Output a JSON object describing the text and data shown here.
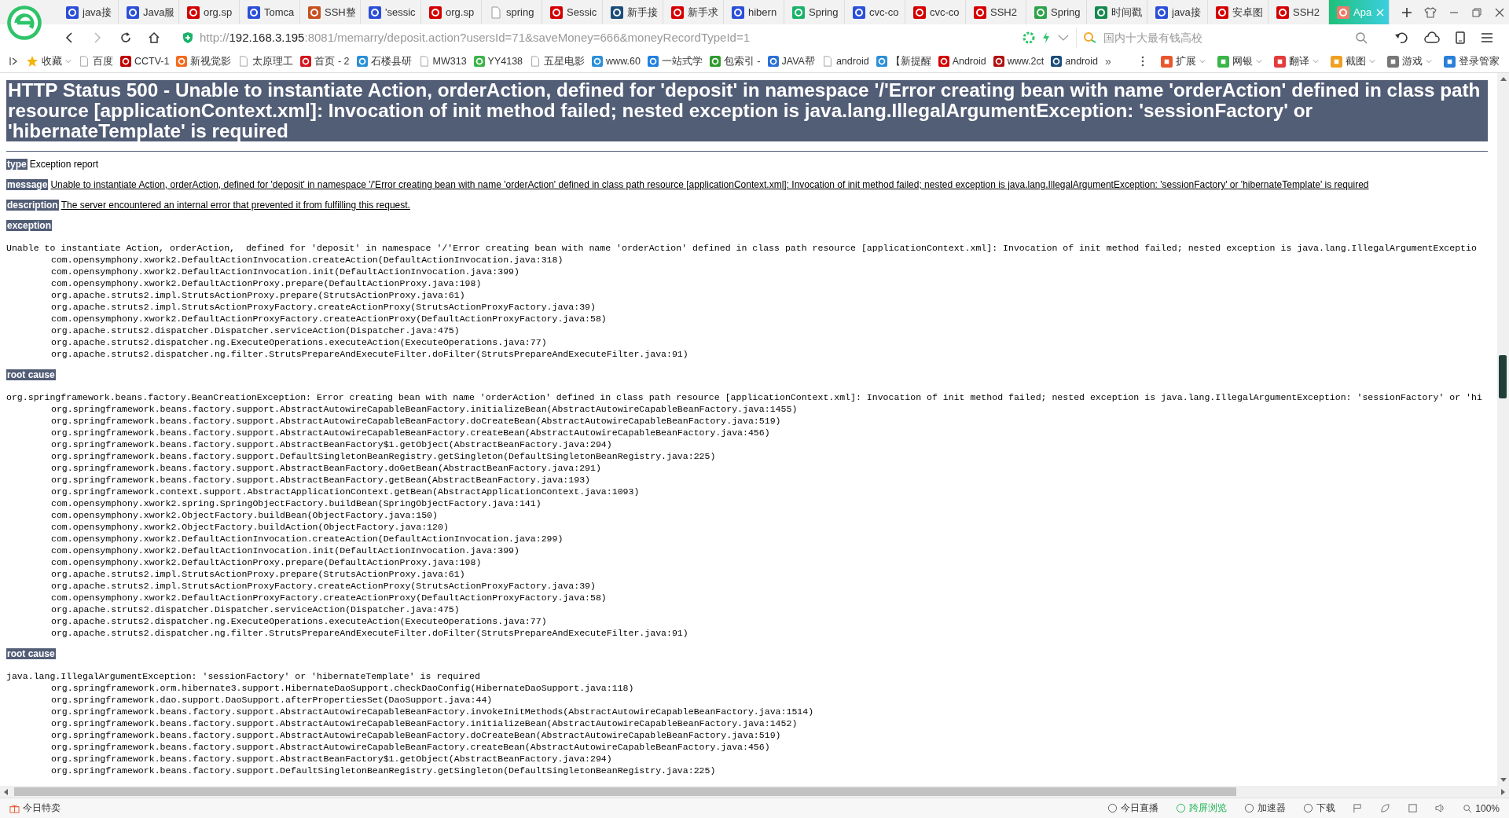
{
  "tabs": [
    {
      "label": "java接",
      "kind": "badge",
      "color": "#2b4fd8",
      "selected": false
    },
    {
      "label": "Java服",
      "kind": "badge",
      "color": "#2b4fd8",
      "selected": false
    },
    {
      "label": "org.sp",
      "kind": "badge",
      "color": "#d40000",
      "selected": false
    },
    {
      "label": "Tomca",
      "kind": "badge",
      "color": "#2b4fd8",
      "selected": false
    },
    {
      "label": "SSH整",
      "kind": "badge",
      "color": "#c8501e",
      "selected": false
    },
    {
      "label": "'sessic",
      "kind": "badge",
      "color": "#2b4fd8",
      "selected": false
    },
    {
      "label": "org.sp",
      "kind": "badge",
      "color": "#d40000",
      "selected": false
    },
    {
      "label": "spring",
      "kind": "page",
      "selected": false
    },
    {
      "label": "Sessic",
      "kind": "badge",
      "color": "#d40000",
      "selected": false
    },
    {
      "label": "新手接",
      "kind": "badge",
      "color": "#1b4d7a",
      "selected": false
    },
    {
      "label": "新手求",
      "kind": "badge",
      "color": "#d40000",
      "selected": false
    },
    {
      "label": "hibern",
      "kind": "badge",
      "color": "#2b4fd8",
      "selected": false
    },
    {
      "label": "Spring",
      "kind": "badge",
      "color": "#19b36b",
      "selected": false
    },
    {
      "label": "cvc-co",
      "kind": "badge",
      "color": "#2b4fd8",
      "selected": false
    },
    {
      "label": "cvc-co",
      "kind": "badge",
      "color": "#d40000",
      "selected": false
    },
    {
      "label": "SSH2",
      "kind": "badge",
      "color": "#d40000",
      "selected": false
    },
    {
      "label": "Spring",
      "kind": "badge",
      "color": "#2fa34b",
      "selected": false
    },
    {
      "label": "时间戳",
      "kind": "badge",
      "color": "#16894f",
      "selected": false
    },
    {
      "label": "java接",
      "kind": "badge",
      "color": "#2b4fd8",
      "selected": false
    },
    {
      "label": "安卓图",
      "kind": "badge",
      "color": "#d40000",
      "selected": false
    },
    {
      "label": "SSH2",
      "kind": "badge",
      "color": "#d40000",
      "selected": false
    },
    {
      "label": "Apa",
      "kind": "badge",
      "color": "#f07a6a",
      "selected": true
    }
  ],
  "address": {
    "scheme": "http://",
    "host": "192.168.3.195",
    "rest": ":8081/memarry/deposit.action?usersId=71&saveMoney=666&moneyRecordTypeId=1"
  },
  "search": {
    "placeholder": "国内十大最有钱高校"
  },
  "bookmarks": [
    {
      "label": "收藏",
      "kind": "star",
      "color": "#f5b400"
    },
    {
      "label": "百度",
      "kind": "page"
    },
    {
      "label": "CCTV-1",
      "kind": "badge",
      "color": "#c00000"
    },
    {
      "label": "新视觉影",
      "kind": "badge",
      "color": "#f26b1d"
    },
    {
      "label": "太原理工",
      "kind": "page"
    },
    {
      "label": "首页 - 2",
      "kind": "badge",
      "color": "#d4141c"
    },
    {
      "label": "石楼县研",
      "kind": "badge",
      "color": "#2a8fd8"
    },
    {
      "label": "MW313",
      "kind": "page"
    },
    {
      "label": "YY4138",
      "kind": "badge",
      "color": "#3bb54a"
    },
    {
      "label": "五星电影",
      "kind": "page"
    },
    {
      "label": "www.60",
      "kind": "badge",
      "color": "#2a8fd8"
    },
    {
      "label": "一站式学",
      "kind": "badge",
      "color": "#1f7fe0"
    },
    {
      "label": "包索引 -",
      "kind": "badge",
      "color": "#2e9b2e"
    },
    {
      "label": "JAVA帮",
      "kind": "badge",
      "color": "#2a6fd8"
    },
    {
      "label": "android",
      "kind": "page"
    },
    {
      "label": "【新提醒",
      "kind": "badge",
      "color": "#2a8fd8"
    },
    {
      "label": "Android",
      "kind": "badge",
      "color": "#d40000"
    },
    {
      "label": "www.2ct",
      "kind": "badge",
      "color": "#b01010"
    },
    {
      "label": "android",
      "kind": "badge",
      "color": "#1b4d7a"
    }
  ],
  "more": "»",
  "extensions": [
    {
      "label": "扩展",
      "color": "#e8552e",
      "dropdown": true
    },
    {
      "label": "网银",
      "color": "#3bb54a",
      "dropdown": true
    },
    {
      "label": "翻译",
      "color": "#e33c3c",
      "dropdown": true
    },
    {
      "label": "截图",
      "color": "#f0a020",
      "dropdown": true
    },
    {
      "label": "游戏",
      "color": "#777777",
      "dropdown": true
    },
    {
      "label": "登录管家",
      "color": "#2a7fd8",
      "dropdown": false
    }
  ],
  "report": {
    "title": "HTTP Status 500 - Unable to instantiate Action, orderAction, defined for 'deposit' in namespace '/'Error creating bean with name 'orderAction' defined in class path resource [applicationContext.xml]: Invocation of init method failed; nested exception is java.lang.IllegalArgumentException: 'sessionFactory' or 'hibernateTemplate' is required",
    "fields": [
      {
        "label": "type",
        "text": "Exception report",
        "underlined": false
      },
      {
        "label": "message",
        "text": "Unable to instantiate Action, orderAction, defined for 'deposit' in namespace '/'Error creating bean with name 'orderAction' defined in class path resource [applicationContext.xml]: Invocation of init method failed; nested exception is java.lang.IllegalArgumentException: 'sessionFactory' or 'hibernateTemplate' is required",
        "underlined": true
      },
      {
        "label": "description",
        "text": "The server encountered an internal error that prevented it from fulfilling this request.",
        "underlined": true
      }
    ],
    "traces": [
      {
        "label": "exception",
        "first": "Unable to instantiate Action, orderAction,  defined for 'deposit' in namespace '/'Error creating bean with name 'orderAction' defined in class path resource [applicationContext.xml]: Invocation of init method failed; nested exception is java.lang.IllegalArgumentExceptio",
        "frames": [
          "com.opensymphony.xwork2.DefaultActionInvocation.createAction(DefaultActionInvocation.java:318)",
          "com.opensymphony.xwork2.DefaultActionInvocation.init(DefaultActionInvocation.java:399)",
          "com.opensymphony.xwork2.DefaultActionProxy.prepare(DefaultActionProxy.java:198)",
          "org.apache.struts2.impl.StrutsActionProxy.prepare(StrutsActionProxy.java:61)",
          "org.apache.struts2.impl.StrutsActionProxyFactory.createActionProxy(StrutsActionProxyFactory.java:39)",
          "com.opensymphony.xwork2.DefaultActionProxyFactory.createActionProxy(DefaultActionProxyFactory.java:58)",
          "org.apache.struts2.dispatcher.Dispatcher.serviceAction(Dispatcher.java:475)",
          "org.apache.struts2.dispatcher.ng.ExecuteOperations.executeAction(ExecuteOperations.java:77)",
          "org.apache.struts2.dispatcher.ng.filter.StrutsPrepareAndExecuteFilter.doFilter(StrutsPrepareAndExecuteFilter.java:91)"
        ]
      },
      {
        "label": "root cause",
        "first": "org.springframework.beans.factory.BeanCreationException: Error creating bean with name 'orderAction' defined in class path resource [applicationContext.xml]: Invocation of init method failed; nested exception is java.lang.IllegalArgumentException: 'sessionFactory' or 'hi",
        "frames": [
          "org.springframework.beans.factory.support.AbstractAutowireCapableBeanFactory.initializeBean(AbstractAutowireCapableBeanFactory.java:1455)",
          "org.springframework.beans.factory.support.AbstractAutowireCapableBeanFactory.doCreateBean(AbstractAutowireCapableBeanFactory.java:519)",
          "org.springframework.beans.factory.support.AbstractAutowireCapableBeanFactory.createBean(AbstractAutowireCapableBeanFactory.java:456)",
          "org.springframework.beans.factory.support.AbstractBeanFactory$1.getObject(AbstractBeanFactory.java:294)",
          "org.springframework.beans.factory.support.DefaultSingletonBeanRegistry.getSingleton(DefaultSingletonBeanRegistry.java:225)",
          "org.springframework.beans.factory.support.AbstractBeanFactory.doGetBean(AbstractBeanFactory.java:291)",
          "org.springframework.beans.factory.support.AbstractBeanFactory.getBean(AbstractBeanFactory.java:193)",
          "org.springframework.context.support.AbstractApplicationContext.getBean(AbstractApplicationContext.java:1093)",
          "com.opensymphony.xwork2.spring.SpringObjectFactory.buildBean(SpringObjectFactory.java:141)",
          "com.opensymphony.xwork2.ObjectFactory.buildBean(ObjectFactory.java:150)",
          "com.opensymphony.xwork2.ObjectFactory.buildAction(ObjectFactory.java:120)",
          "com.opensymphony.xwork2.DefaultActionInvocation.createAction(DefaultActionInvocation.java:299)",
          "com.opensymphony.xwork2.DefaultActionInvocation.init(DefaultActionInvocation.java:399)",
          "com.opensymphony.xwork2.DefaultActionProxy.prepare(DefaultActionProxy.java:198)",
          "org.apache.struts2.impl.StrutsActionProxy.prepare(StrutsActionProxy.java:61)",
          "org.apache.struts2.impl.StrutsActionProxyFactory.createActionProxy(StrutsActionProxyFactory.java:39)",
          "com.opensymphony.xwork2.DefaultActionProxyFactory.createActionProxy(DefaultActionProxyFactory.java:58)",
          "org.apache.struts2.dispatcher.Dispatcher.serviceAction(Dispatcher.java:475)",
          "org.apache.struts2.dispatcher.ng.ExecuteOperations.executeAction(ExecuteOperations.java:77)",
          "org.apache.struts2.dispatcher.ng.filter.StrutsPrepareAndExecuteFilter.doFilter(StrutsPrepareAndExecuteFilter.java:91)"
        ]
      },
      {
        "label": "root cause",
        "first": "java.lang.IllegalArgumentException: 'sessionFactory' or 'hibernateTemplate' is required",
        "frames": [
          "org.springframework.orm.hibernate3.support.HibernateDaoSupport.checkDaoConfig(HibernateDaoSupport.java:118)",
          "org.springframework.dao.support.DaoSupport.afterPropertiesSet(DaoSupport.java:44)",
          "org.springframework.beans.factory.support.AbstractAutowireCapableBeanFactory.invokeInitMethods(AbstractAutowireCapableBeanFactory.java:1514)",
          "org.springframework.beans.factory.support.AbstractAutowireCapableBeanFactory.initializeBean(AbstractAutowireCapableBeanFactory.java:1452)",
          "org.springframework.beans.factory.support.AbstractAutowireCapableBeanFactory.doCreateBean(AbstractAutowireCapableBeanFactory.java:519)",
          "org.springframework.beans.factory.support.AbstractAutowireCapableBeanFactory.createBean(AbstractAutowireCapableBeanFactory.java:456)",
          "org.springframework.beans.factory.support.AbstractBeanFactory$1.getObject(AbstractBeanFactory.java:294)",
          "org.springframework.beans.factory.support.DefaultSingletonBeanRegistry.getSingleton(DefaultSingletonBeanRegistry.java:225)"
        ]
      }
    ]
  },
  "status_bar": {
    "left": "今日特卖",
    "items": [
      {
        "label": "今日直播",
        "highlighted": false
      },
      {
        "label": "跨屏浏览",
        "highlighted": true
      },
      {
        "label": "加速器",
        "highlighted": false
      },
      {
        "label": "下载",
        "highlighted": false
      }
    ],
    "zoom": "100%"
  }
}
